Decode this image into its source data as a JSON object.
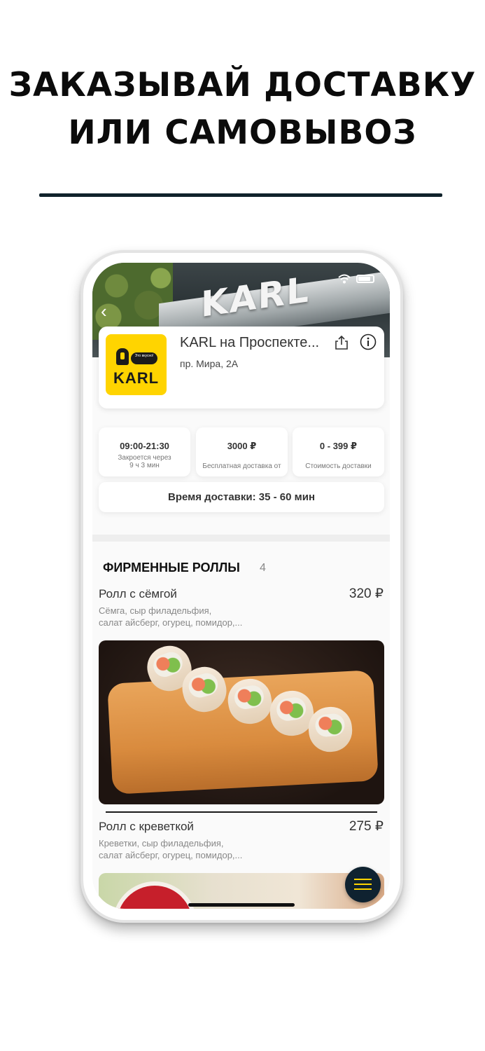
{
  "headline": {
    "line1": "ЗАКАЗЫВАЙ ДОСТАВКУ",
    "line2": "ИЛИ САМОВЫВОЗ"
  },
  "hero": {
    "sign_text": "KARL"
  },
  "restaurant": {
    "logo_text": "KARL",
    "logo_bubble": "Это вкусно!",
    "title": "KARL на Проспекте...",
    "address": "пр. Мира, 2А"
  },
  "stats": [
    {
      "value": "09:00-21:30",
      "label_line1": "Закроется через",
      "label_line2": "9 ч 3 мин"
    },
    {
      "value": "3000 ₽",
      "label_line1": "Бесплатная доставка от",
      "label_line2": ""
    },
    {
      "value": "0 - 399 ₽",
      "label_line1": "Стоимость доставки",
      "label_line2": ""
    }
  ],
  "delivery_time": "Время доставки: 35 - 60 мин",
  "section": {
    "title": "ФИРМЕННЫЕ РОЛЛЫ",
    "count": "4"
  },
  "items": [
    {
      "name": "Ролл с сёмгой",
      "price": "320 ₽",
      "desc_line1": "Сёмга, сыр филадельфия,",
      "desc_line2": "салат айсберг, огурец, помидор,..."
    },
    {
      "name": "Ролл с креветкой",
      "price": "275 ₽",
      "desc_line1": "Креветки, сыр филадельфия,",
      "desc_line2": "салат айсберг, огурец, помидор,..."
    }
  ],
  "icons": {
    "back": "back-arrow-icon",
    "share": "share-icon",
    "info": "info-icon",
    "menu": "menu-icon",
    "wifi": "wifi-icon",
    "battery": "battery-icon"
  },
  "colors": {
    "brand_yellow": "#ffd400",
    "dark_navy": "#0f2230",
    "rule": "#10222b"
  }
}
